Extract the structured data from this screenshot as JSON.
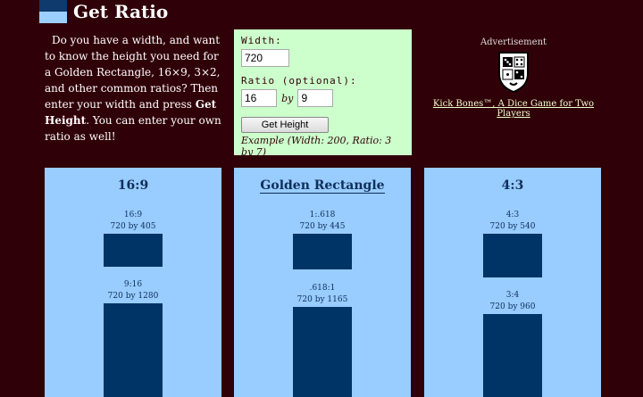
{
  "header": {
    "title": "Get Ratio"
  },
  "intro": {
    "lead": "Do you have a width, and want to know the height you need for a Golden Rectangle, 16×9, 3×2, and other common ratios? Then enter your width and press ",
    "button_ref": "Get Height",
    "trail": ". You can enter your own ratio as well!"
  },
  "form": {
    "width_label": "Width:",
    "width_value": "720",
    "ratio_label": "Ratio (optional):",
    "ratio_a": "16",
    "ratio_by": "by",
    "ratio_b": "9",
    "button_label": "Get Height",
    "example": "Example (Width: 200, Ratio: 3 by 7)"
  },
  "ad": {
    "label": "Advertisement",
    "link_text": "Kick Bones™, A Dice Game for Two Players",
    "logo_icon": "dice-shield-icon"
  },
  "panels": [
    {
      "title": "16:9",
      "items": [
        {
          "ratio": "16:9",
          "size": "720 by 405"
        },
        {
          "ratio": "9:16",
          "size": "720 by 1280"
        }
      ]
    },
    {
      "title": "Golden Rectangle",
      "items": [
        {
          "ratio": "1:.618",
          "size": "720 by 445"
        },
        {
          "ratio": ".618:1",
          "size": "720 by 1165"
        }
      ]
    },
    {
      "title": "4:3",
      "items": [
        {
          "ratio": "4:3",
          "size": "720 by 540"
        },
        {
          "ratio": "3:4",
          "size": "720 by 960"
        }
      ]
    }
  ],
  "colors": {
    "background": "#300008",
    "panel": "#99ccff",
    "rect": "#003366",
    "form": "#ccffcc"
  }
}
